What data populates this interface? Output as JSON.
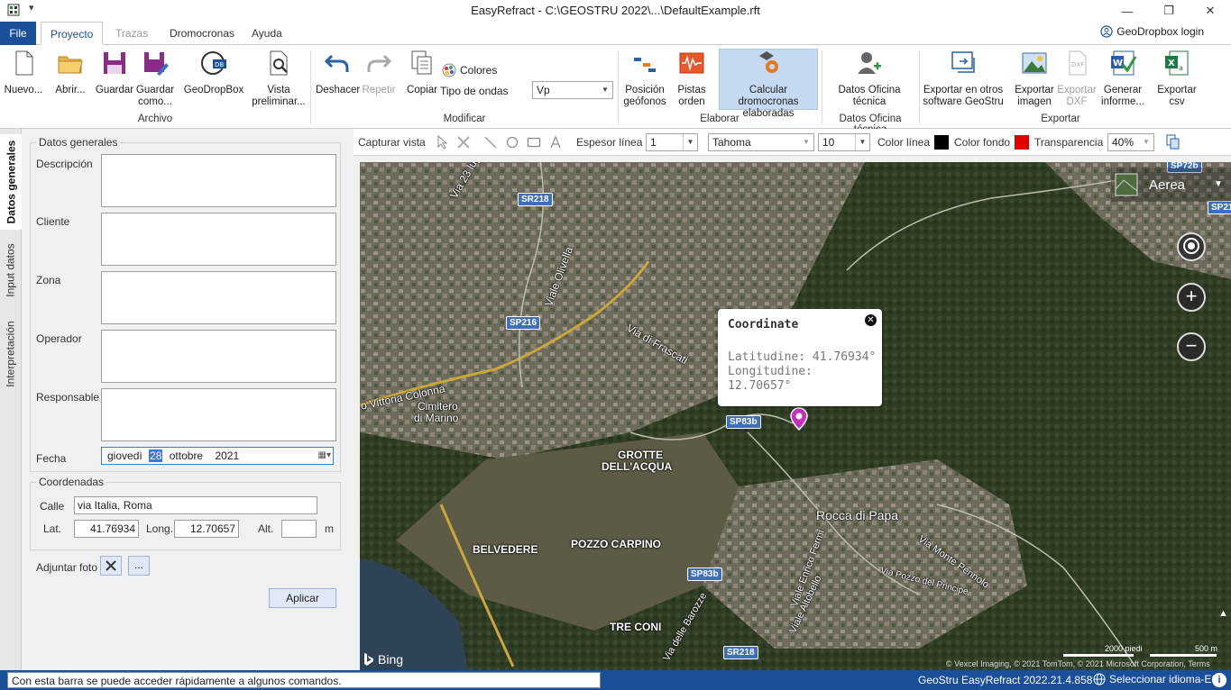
{
  "window": {
    "title": "EasyRefract - C:\\GEOSTRU 2022\\...\\DefaultExample.rft",
    "quick_access": "▾",
    "minimize": "—",
    "maximize": "❐",
    "close": "✕"
  },
  "tabs": {
    "file": "File",
    "proyecto": "Proyecto",
    "trazas": "Trazas",
    "dromocronas": "Dromocronas",
    "ayuda": "Ayuda",
    "login": "GeoDropbox login"
  },
  "ribbon": {
    "nuevo": "Nuevo...",
    "abrir": "Abrir...",
    "guardar": "Guardar",
    "guardar_como_1": "Guardar",
    "guardar_como_2": "como...",
    "geodropbox": "GeoDropBox",
    "vista_1": "Vista",
    "vista_2": "preliminar...",
    "archivo_group": "Archivo",
    "deshacer": "Deshacer",
    "repetir": "Repetir",
    "copiar": "Copiar",
    "colores": "Colores",
    "tipo_ondas": "Tipo de ondas",
    "tipo_ondas_value": "Vp",
    "modificar_group": "Modificar",
    "posicion_1": "Posición",
    "posicion_2": "geófonos",
    "pistas_1": "Pistas",
    "pistas_2": "orden",
    "calcular_1": "Calcular dromocronas",
    "calcular_2": "elaboradas",
    "elaborar_group": "Elaborar",
    "datos_oficina_1": "Datos Oficina",
    "datos_oficina_2": "técnica",
    "datos_oficina_group": "Datos Oficina técnica",
    "exportar_otros_1": "Exportar en otros",
    "exportar_otros_2": "software GeoStru",
    "exportar_imagen_1": "Exportar",
    "exportar_imagen_2": "imagen",
    "exportar_dxf_1": "Exportar",
    "exportar_dxf_2": "DXF",
    "generar_1": "Generar",
    "generar_2": "informe...",
    "exportar_csv_1": "Exportar",
    "exportar_csv_2": "csv",
    "exportar_group": "Exportar"
  },
  "side_tabs": {
    "datos_generales": "Datos generales",
    "input_datos": "Input datos",
    "interpretacion": "Interpretación"
  },
  "form": {
    "datos_generales": "Datos generales",
    "descripcion": "Descripción",
    "cliente": "Cliente",
    "zona": "Zona",
    "operador": "Operador",
    "responsable": "Responsable",
    "fecha": "Fecha",
    "fecha_weekday": "giovedì",
    "fecha_day": "28",
    "fecha_month": "ottobre",
    "fecha_year": "2021",
    "coordenadas": "Coordenadas",
    "calle": "Calle",
    "calle_value": "via Italia, Roma",
    "lat": "Lat.",
    "lat_value": "41.76934",
    "long": "Long.",
    "long_value": "12.70657",
    "alt": "Alt.",
    "alt_value": "",
    "m": "m",
    "adjuntar": "Adjuntar foto",
    "browse": "...",
    "aplicar": "Aplicar"
  },
  "map_toolbar": {
    "capturar": "Capturar vista",
    "espesor": "Espesor línea",
    "espesor_value": "1",
    "font": "Tahoma",
    "font_size": "10",
    "color_linea": "Color línea",
    "color_linea_hex": "#000000",
    "color_fondo": "Color fondo",
    "color_fondo_hex": "#e00000",
    "transparencia": "Transparencia",
    "transparencia_value": "40%"
  },
  "map": {
    "aerea": "Aerea",
    "popup_title": "Coordinate",
    "popup_lat": "Latitudine: 41.76934°",
    "popup_lon_1": "Longitudine:",
    "popup_lon_2": "12.70657°",
    "bing": "Bing",
    "scale_ft": "2000 piedi",
    "scale_m": "500 m",
    "copyright": "© Vexcel Imaging, © 2021 TomTom, © 2021 Microsoft Corporation, Terms",
    "labels": {
      "rocca": "Rocca di Papa",
      "grotte_1": "GROTTE",
      "grotte_2": "DELL'ACQUA",
      "belvedere": "BELVEDERE",
      "pozzo": "POZZO CARPINO",
      "tre_coni": "TRE CONI",
      "cimitero_1": "Cimitero",
      "cimitero_2": "di Marino",
      "vittoria": "o Vittoria Colonna",
      "frascati": "Via di Frascati",
      "monte_pennolo": "Via Monte Pennolo",
      "pozzo_principe": "Via Pozzo del Principe",
      "enrico_fermi": "Viale Enrico Fermi",
      "altobello": "Viale Altobello",
      "barozze": "Via delle Barozze",
      "luglio": "Via 23 luglio",
      "olivella": "Viale Olivella"
    },
    "shields": {
      "sr218a": "SR218",
      "sp216": "SP216",
      "sp83b_a": "SP83b",
      "sp83b_b": "SP83b",
      "sr218b": "SR218",
      "sp72": "SP72b",
      "sp215": "SP215"
    }
  },
  "status": {
    "hint": "Con esta barra se puede acceder rápidamente a algunos comandos.",
    "version": "GeoStru EasyRefract 2022.21.4.858",
    "language": "Seleccionar idioma-ES",
    "info": "i"
  }
}
